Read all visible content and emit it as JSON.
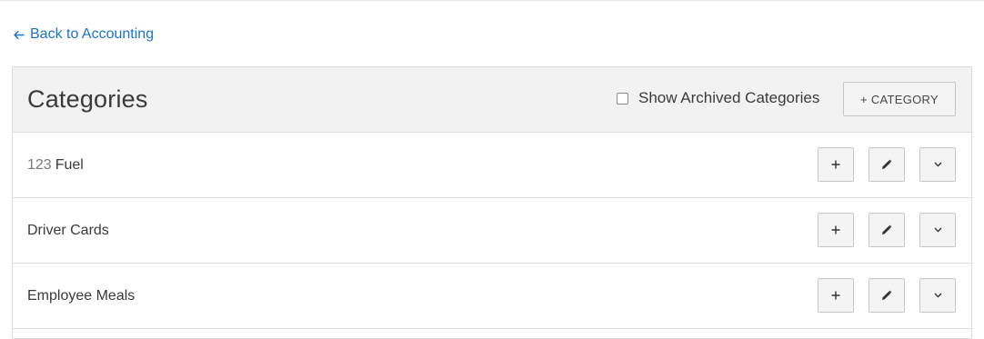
{
  "nav": {
    "back_label": "Back to Accounting"
  },
  "header": {
    "title": "Categories",
    "show_archived_label": "Show Archived Categories",
    "show_archived_checked": false,
    "add_category_label": "+ CATEGORY"
  },
  "rows": [
    {
      "code": "123",
      "name": "Fuel"
    },
    {
      "code": "",
      "name": "Driver Cards"
    },
    {
      "code": "",
      "name": "Employee Meals"
    }
  ],
  "icons": {
    "back": "arrow-left-icon",
    "add": "plus-icon",
    "edit": "pencil-icon",
    "expand": "chevron-down-icon"
  },
  "colors": {
    "link": "#1a73c9",
    "header_bg": "#f2f2f2",
    "button_bg": "#f4f4f4",
    "border": "#dcdcdc"
  }
}
